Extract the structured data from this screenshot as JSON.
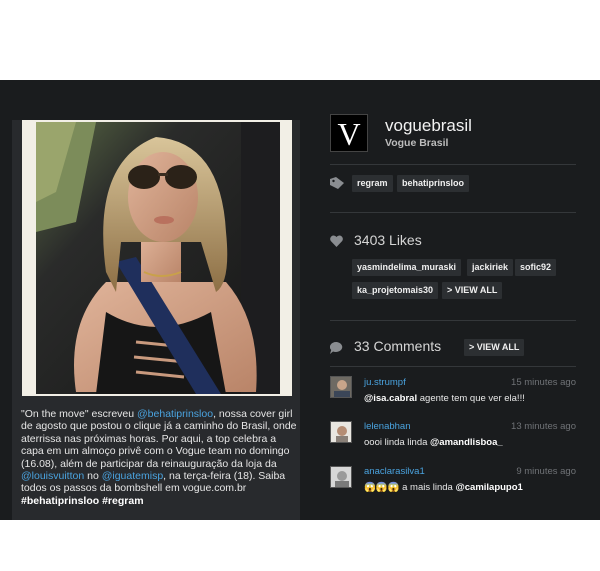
{
  "post": {
    "username": "voguebrasil",
    "fullname": "Vogue Brasil",
    "logo_letter": "V",
    "caption": {
      "prefix": "\"On the move\" escreveu ",
      "mention1": "@behatiprinsloo",
      "part2": ", nossa cover girl de agosto que postou o clique já a caminho do Brasil, onde aterrissa nas próximas horas. Por aqui, a top celebra a capa em um almoço privê com o Vogue team no domingo (16.08), além de participar da reinauguração da loja da ",
      "mention2": "@louisvuitton",
      "part3": " no ",
      "mention3": "@iguatemisp",
      "part4": ", na terça-feira (18). Saiba todos os passos da bombshell em vogue.com.br ",
      "tags": "#behatiprinsloo #regram"
    }
  },
  "tags": [
    "regram",
    "behatiprinsloo"
  ],
  "likes": {
    "label": "3403 Likes",
    "users": [
      "yasmindelima_muraski",
      "jackiriek",
      "sofic92",
      "ka_projetomais30"
    ],
    "view_all": "> VIEW ALL"
  },
  "comments": {
    "label": "33 Comments",
    "view_all": "> VIEW ALL",
    "items": [
      {
        "user": "ju.strumpf",
        "time": "15 minutes ago",
        "mention": "@isa.cabral",
        "text": " agente tem que ver ela!!!"
      },
      {
        "user": "lelenabhan",
        "time": "13 minutes ago",
        "text": "oooi linda linda ",
        "mention": "@amandlisboa_"
      },
      {
        "user": "anaclarasilva1",
        "time": "9 minutes ago",
        "emoji": "😱😱😱",
        "text": " a mais linda ",
        "mention": "@camilapupo1"
      }
    ]
  },
  "icons": [
    "tag-icon",
    "heart-icon",
    "comment-bubble-icon"
  ],
  "colors": {
    "background": "#1a1c1e",
    "card": "#282a2d",
    "link": "#4aa3df",
    "chip": "#2c2f32"
  }
}
